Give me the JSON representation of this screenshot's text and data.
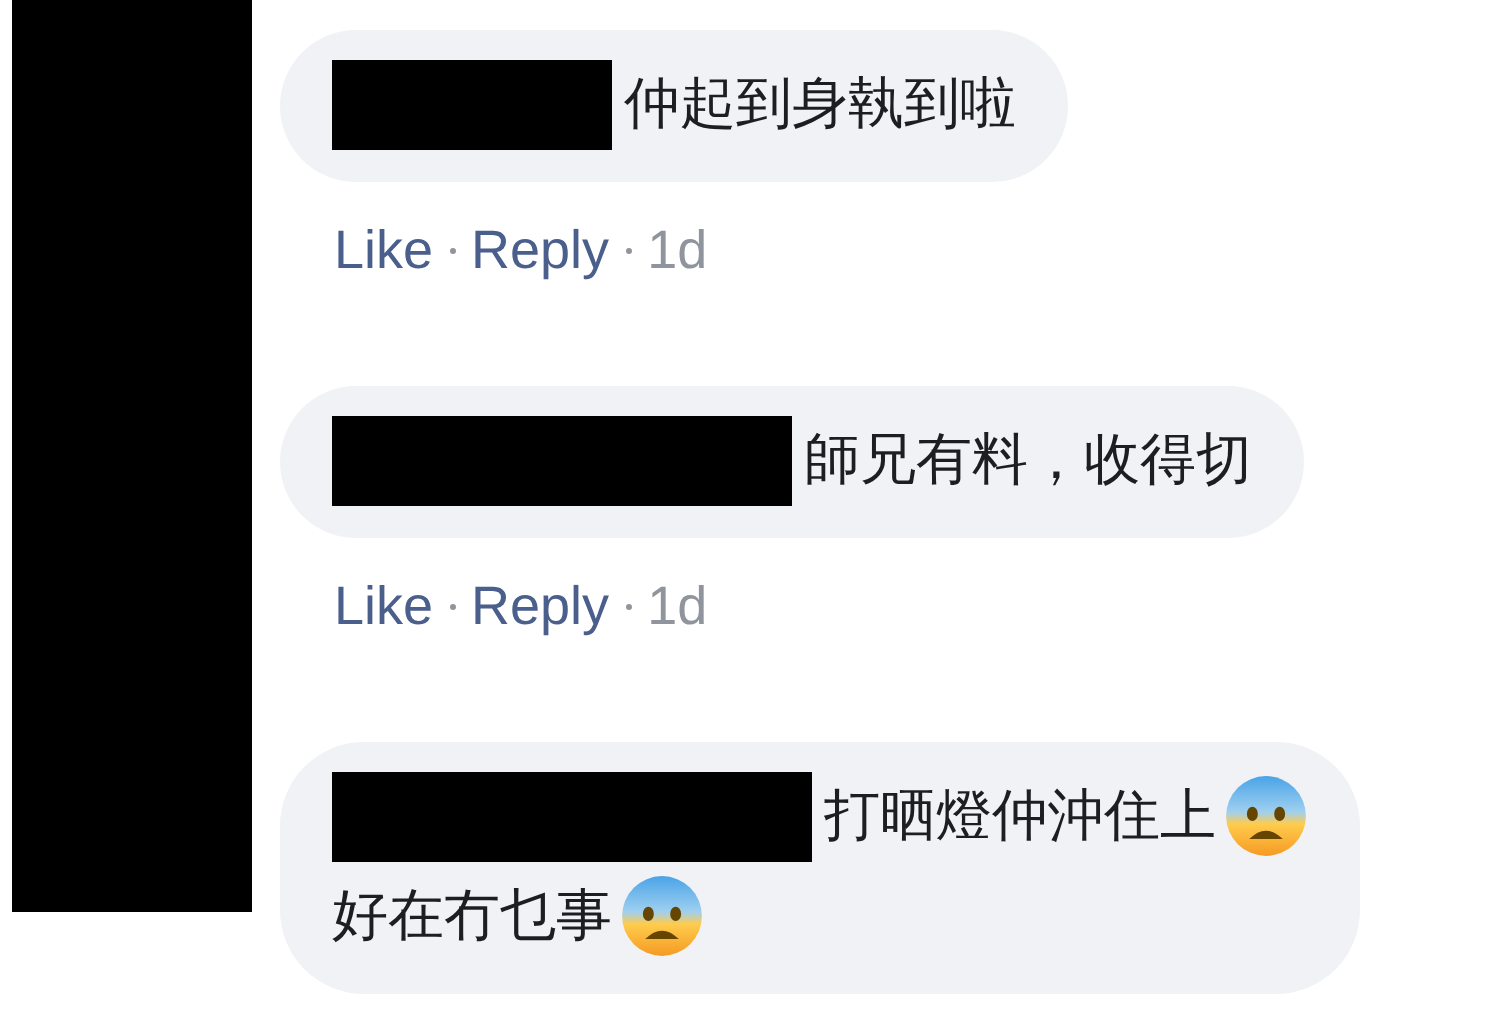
{
  "comments": [
    {
      "lines": [
        {
          "text": "仲起到身執到啦",
          "emoji": false
        }
      ],
      "actions": [
        "Like",
        "Reply"
      ],
      "time": "1d"
    },
    {
      "lines": [
        {
          "text": "師兄有料，收得切",
          "emoji": false
        }
      ],
      "actions": [
        "Like",
        "Reply"
      ],
      "time": "1d"
    },
    {
      "lines": [
        {
          "text": "打晒燈仲沖住上",
          "emoji": true
        },
        {
          "text": "好在冇乜事",
          "emoji": true
        }
      ]
    }
  ]
}
